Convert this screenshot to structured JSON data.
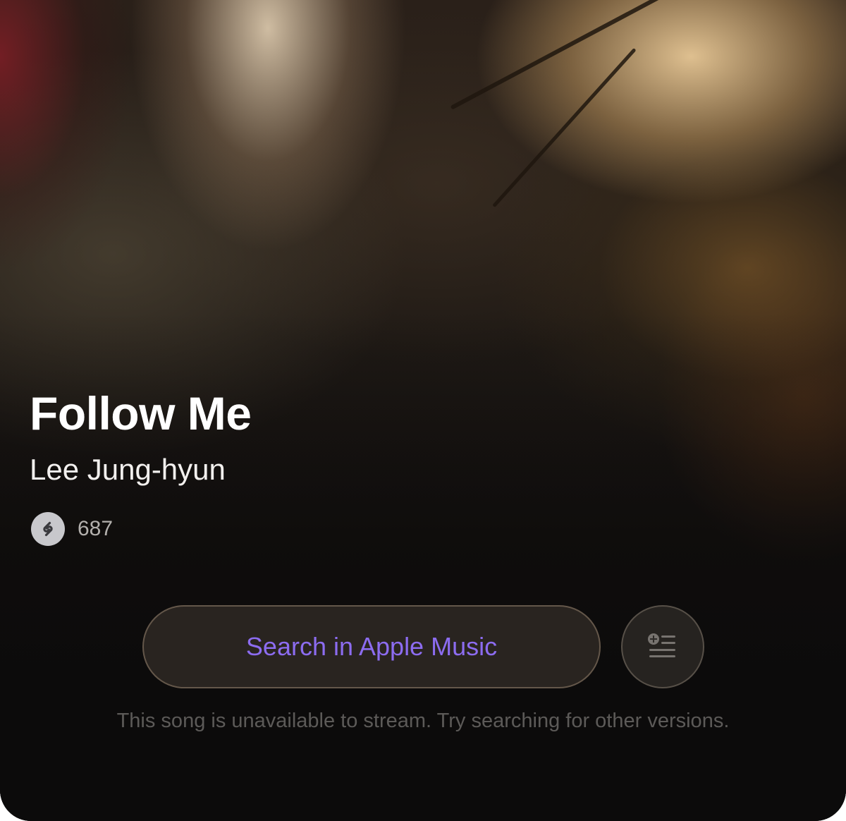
{
  "song": {
    "title": "Follow Me",
    "artist": "Lee Jung-hyun",
    "shazam_count": "687"
  },
  "actions": {
    "search_label": "Search in Apple Music",
    "queue_icon": "add-to-queue-icon"
  },
  "notice": "This song is unavailable to stream. Try searching for other versions.",
  "colors": {
    "accent": "#8c6cf0",
    "background": "#0c0b0b",
    "title_text": "#ffffff",
    "muted_text": "#5c5a58"
  }
}
